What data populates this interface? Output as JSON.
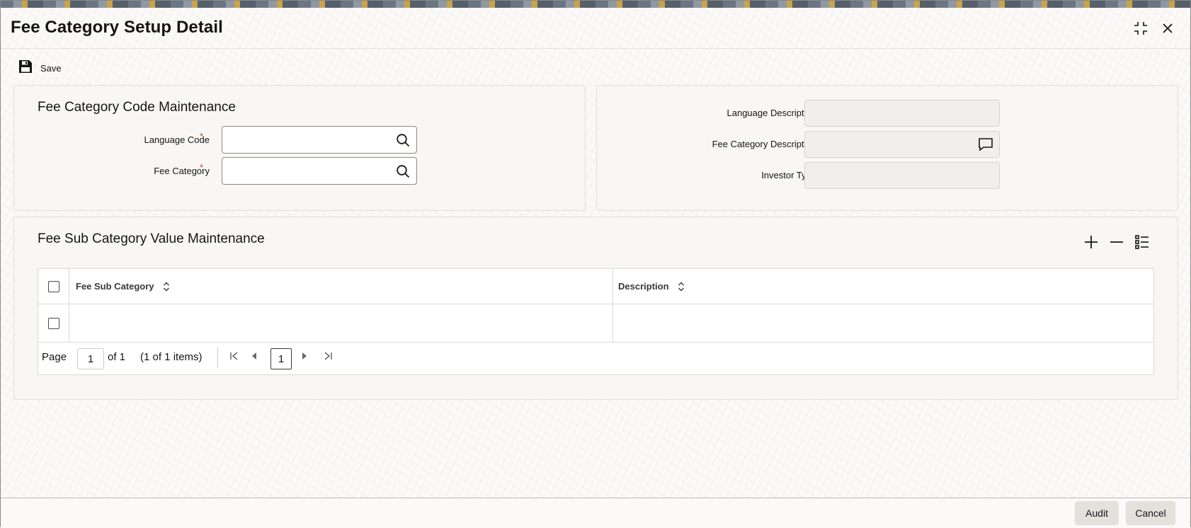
{
  "window": {
    "title": "Fee Category Setup Detail"
  },
  "toolbar": {
    "save_label": "Save"
  },
  "code_maintenance": {
    "title": "Fee Category Code Maintenance",
    "language_code_label": "Language Code",
    "language_code_value": "",
    "fee_category_label": "Fee Category",
    "fee_category_value": "",
    "required_mark": "*"
  },
  "descriptions": {
    "language_description_label": "Language Description",
    "language_description_value": "",
    "fee_category_description_label": "Fee Category Description",
    "fee_category_description_value": "",
    "investor_type_label": "Investor Type",
    "investor_type_value": ""
  },
  "sub_category": {
    "title": "Fee Sub Category Value Maintenance",
    "columns": [
      "Fee Sub Category",
      "Description"
    ],
    "rows": [
      {
        "fee_sub_category": "",
        "description": ""
      }
    ]
  },
  "pager": {
    "page_label": "Page",
    "current_page": "1",
    "of_text": "of 1",
    "items_text": "(1 of 1 items)",
    "page_button": "1"
  },
  "footer": {
    "audit_label": "Audit",
    "cancel_label": "Cancel"
  },
  "colors": {
    "required": "#c74634",
    "panel_bg": "#f8f7f5",
    "button_bg": "#e4e1dd"
  },
  "icons": {
    "save": "floppy-disk-icon",
    "maximize": "maximize-icon",
    "close": "close-icon",
    "search": "search-icon",
    "comment": "comment-icon",
    "add": "plus-icon",
    "remove": "minus-icon",
    "columns": "list-settings-icon"
  }
}
